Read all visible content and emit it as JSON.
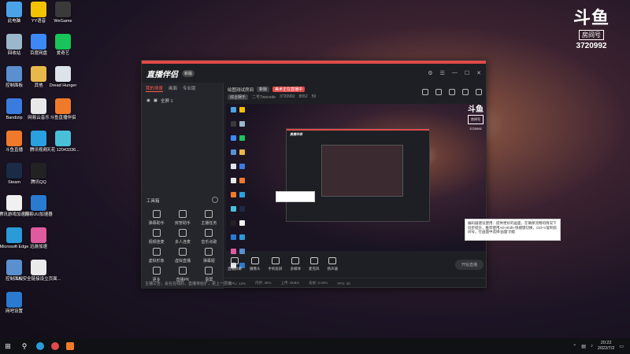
{
  "desktop": {
    "icons": [
      {
        "label": "此电脑",
        "color": "#4aa3e8",
        "col": 0,
        "row": 0
      },
      {
        "label": "YY语音",
        "color": "#f2c200",
        "col": 1,
        "row": 0
      },
      {
        "label": "WeGame",
        "color": "#3a3a3a",
        "col": 2,
        "row": 0
      },
      {
        "label": "回收站",
        "color": "#9ab7cc",
        "col": 0,
        "row": 1
      },
      {
        "label": "百度网盘",
        "color": "#3d88f5",
        "col": 1,
        "row": 1
      },
      {
        "label": "爱奇艺",
        "color": "#19c45a",
        "col": 2,
        "row": 1
      },
      {
        "label": "控制面板",
        "color": "#5a8fd0",
        "col": 0,
        "row": 2
      },
      {
        "label": "其他",
        "color": "#e8b84a",
        "col": 1,
        "row": 2
      },
      {
        "label": "Dread Hunger",
        "color": "#dde3ea",
        "col": 2,
        "row": 2
      },
      {
        "label": "Bandizip",
        "color": "#3a7be0",
        "col": 0,
        "row": 3
      },
      {
        "label": "网易云音乐",
        "color": "#e8e8ea",
        "col": 1,
        "row": 3
      },
      {
        "label": "斗鱼直播伴侣",
        "color": "#f07a2a",
        "col": 2,
        "row": 3
      },
      {
        "label": "斗鱼直播",
        "color": "#f07a2a",
        "col": 0,
        "row": 4
      },
      {
        "label": "腾讯视频",
        "color": "#2aa0e0",
        "col": 1,
        "row": 4
      },
      {
        "label": "天花 12043336...",
        "color": "#4ac0d8",
        "col": 2,
        "row": 4
      },
      {
        "label": "Steam",
        "color": "#1b2b45",
        "col": 0,
        "row": 5
      },
      {
        "label": "腾讯QQ",
        "color": "#222222",
        "col": 1,
        "row": 5
      },
      {
        "label": "腾讯游戏加速器",
        "color": "#f0f0f0",
        "col": 0,
        "row": 6
      },
      {
        "label": "网易UU加速器",
        "color": "#2a7ad0",
        "col": 1,
        "row": 6
      },
      {
        "label": "Microsoft Edge",
        "color": "#2a9ad8",
        "col": 0,
        "row": 7
      },
      {
        "label": "迅游加速",
        "color": "#e05aa0",
        "col": 1,
        "row": 7
      },
      {
        "label": "控制面板",
        "color": "#5a8fd0",
        "col": 0,
        "row": 8
      },
      {
        "label": "UU安全链接设立页面...",
        "color": "#eaeaea",
        "col": 1,
        "row": 8
      },
      {
        "label": "网吧设置",
        "color": "#2a7ad0",
        "col": 0,
        "row": 9
      }
    ]
  },
  "badge": {
    "logo": "斗鱼",
    "tag": "房间号",
    "room_id": "3720992"
  },
  "app": {
    "title": "直播伴侣",
    "version": "新版",
    "tabs": [
      "我的场景",
      "画面",
      "专业版"
    ],
    "scene_label": "全屏 1",
    "tools_title": "工具箱",
    "tools": [
      {
        "label": "弹幕助手"
      },
      {
        "label": "房管助手"
      },
      {
        "label": "主播任务"
      },
      {
        "label": "视频连麦"
      },
      {
        "label": "多人连麦"
      },
      {
        "label": "音乐点歌"
      },
      {
        "label": "虚拟形象"
      },
      {
        "label": "虚拟直播"
      },
      {
        "label": "弹幕姬"
      },
      {
        "label": "更多"
      },
      {
        "label": "直播PK"
      },
      {
        "label": "录屏"
      }
    ],
    "left_status": "主播公告，会在在线的，直播将给扩，更上一层楼",
    "room": {
      "title": "绘图测试房间",
      "pill_a": "新版",
      "pill_b": "美术正在直播中",
      "category": "综合娱乐",
      "owner": "二号Twocode",
      "room_id": "3720992",
      "heat": "8552",
      "followers": "59"
    },
    "bottom_tools": [
      {
        "label": "直播屏幕"
      },
      {
        "label": "摄像头"
      },
      {
        "label": "手机投屏"
      },
      {
        "label": "多媒体"
      },
      {
        "label": "麦克风"
      },
      {
        "label": "扬声器"
      }
    ],
    "start_label": "开始直播",
    "status_items": [
      "CPU: 12%",
      "内存: 46%",
      "上传: 0KB/s",
      "丢帧: 0.00%",
      "FPS: 30"
    ],
    "preview_logo": "斗鱼",
    "preview_logo_tag": "房间号",
    "preview_room_id": "3720992",
    "nested_title": "直播伴侣"
  },
  "tooltip": {
    "text": "编码器建议使用：提供更好的画面，在确保流畅的情况下同步提升，推荐使用Alt+Shift+快捷键切换，Ctrl+V复制房间号，在画面中选择'画面'功能"
  },
  "taskbar": {
    "time": "20:22",
    "date": "2022/7/2"
  }
}
